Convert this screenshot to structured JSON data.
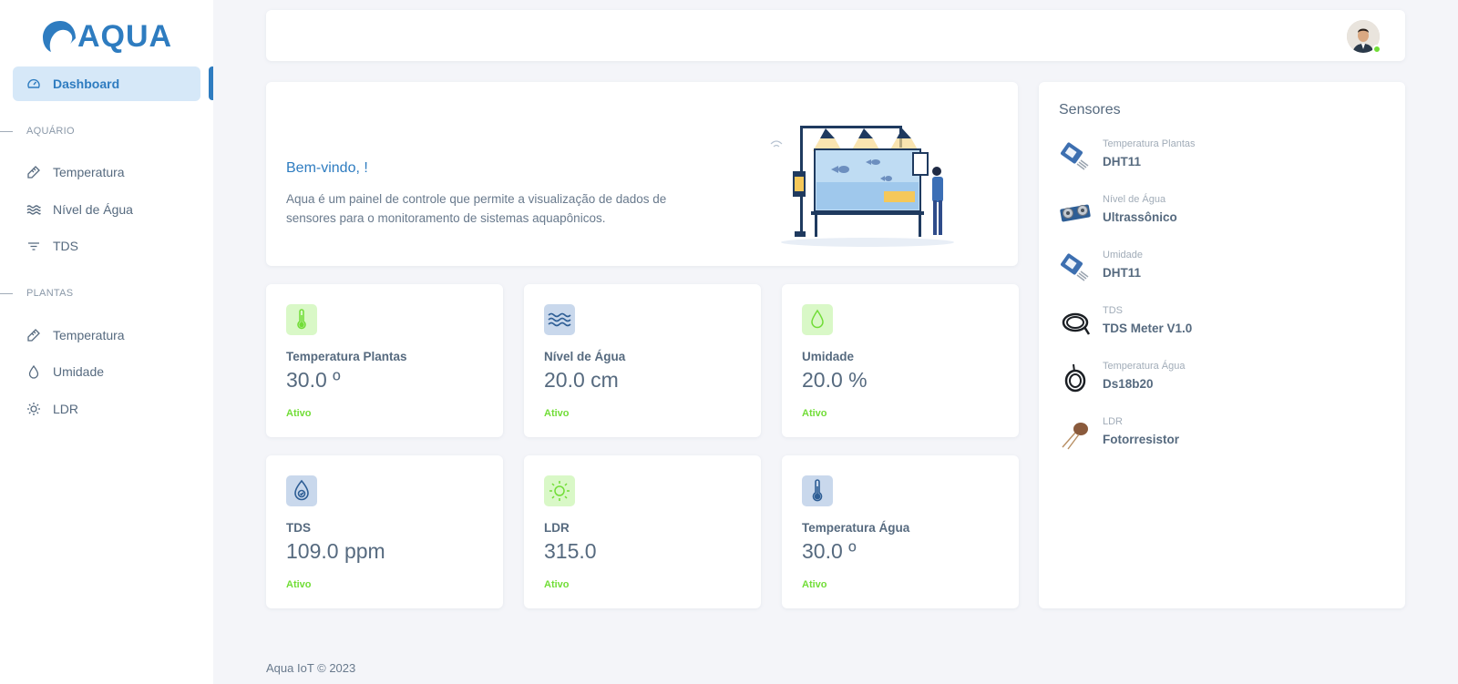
{
  "app": {
    "logo_text": "AQUA"
  },
  "sidebar": {
    "dashboard": {
      "label": "Dashboard",
      "icon": "gauge-icon"
    },
    "sections": [
      {
        "title": "AQUÁRIO"
      },
      {
        "title": "PLANTAS"
      }
    ],
    "aquario_items": [
      {
        "label": "Temperatura",
        "icon": "thermometer-icon"
      },
      {
        "label": "Nível de Água",
        "icon": "waves-icon"
      },
      {
        "label": "TDS",
        "icon": "filter-icon"
      }
    ],
    "plantas_items": [
      {
        "label": "Temperatura",
        "icon": "thermometer-icon"
      },
      {
        "label": "Umidade",
        "icon": "droplet-icon"
      },
      {
        "label": "LDR",
        "icon": "sun-icon"
      }
    ]
  },
  "welcome": {
    "title": "Bem-vindo, !",
    "description": "Aqua é um painel de controle que permite a visualização de dados de sensores para o monitoramento de sistemas aquapônicos."
  },
  "stats": [
    {
      "label": "Temperatura Plantas",
      "value": "30.0 º",
      "status": "Ativo",
      "icon": "thermometer-icon",
      "color": "#d9f8c7"
    },
    {
      "label": "Nível de Água",
      "value": "20.0 cm",
      "status": "Ativo",
      "icon": "waves-icon",
      "color": "#c9d8ec"
    },
    {
      "label": "Umidade",
      "value": "20.0 %",
      "status": "Ativo",
      "icon": "droplet-icon",
      "color": "#d9f8c7"
    },
    {
      "label": "TDS",
      "value": "109.0 ppm",
      "status": "Ativo",
      "icon": "water-quality-icon",
      "color": "#c9d8ec"
    },
    {
      "label": "LDR",
      "value": "315.0",
      "status": "Ativo",
      "icon": "sun-icon",
      "color": "#d9f8c7"
    },
    {
      "label": "Temperatura Água",
      "value": "30.0 º",
      "status": "Ativo",
      "icon": "thermometer-icon",
      "color": "#c9d8ec"
    }
  ],
  "sensors": {
    "title": "Sensores",
    "items": [
      {
        "type": "Temperatura Plantas",
        "name": "DHT11",
        "icon": "dht11-sensor-icon"
      },
      {
        "type": "Nível de Água",
        "name": "Ultrassônico",
        "icon": "ultrasonic-sensor-icon"
      },
      {
        "type": "Umidade",
        "name": "DHT11",
        "icon": "dht11-sensor-icon"
      },
      {
        "type": "TDS",
        "name": "TDS Meter V1.0",
        "icon": "tds-probe-icon"
      },
      {
        "type": "Temperatura Água",
        "name": "Ds18b20",
        "icon": "ds18b20-probe-icon"
      },
      {
        "type": "LDR",
        "name": "Fotorresistor",
        "icon": "ldr-icon"
      }
    ]
  },
  "footer": {
    "text": "Aqua IoT © 2023"
  },
  "colors": {
    "primary": "#2e7cc0",
    "success": "#71dd37",
    "background": "#f4f5f9"
  }
}
